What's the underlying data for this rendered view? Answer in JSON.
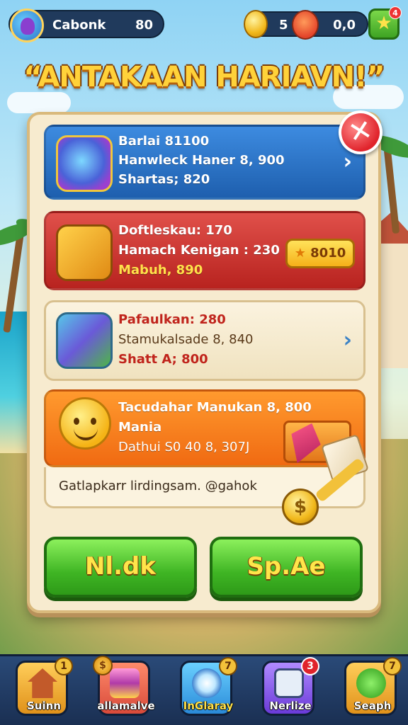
{
  "hud": {
    "player_name": "Cabonk",
    "player_level": "80",
    "coins": "5",
    "gems": "0,0",
    "plus_label": "★",
    "plus_badge": "4"
  },
  "title": "“ANTAKAAN HARIAVN!”",
  "close_label": "✕",
  "tasks": [
    {
      "line1": "Barlai 81100",
      "line2": "Hanwleck Haner 8, 900",
      "line3": "Shartas; 820",
      "icon": "globe-crown-icon",
      "action": "›"
    },
    {
      "line1": "Doftleskau: 170",
      "line2": "Hamach Kenigan : 230",
      "line3": "Mabuh, 890",
      "icon": "treasure-chest-icon",
      "reward_label": "8010",
      "reward_icon": "★"
    },
    {
      "line1": "Pafaulkan: 280",
      "line2": "Stamukalsade 8, 840",
      "line3": "Shatt A; 800",
      "icon": "crate-icon",
      "action": "›"
    },
    {
      "line1": "Tacudahar Manukan 8, 800",
      "line2": "Mania",
      "line3": "Dathui S0 40 8, 307J",
      "icon": "smiley-fruit-icon",
      "footer": "Gatlapkarr lirdingsam. @gahok"
    }
  ],
  "loot_coin": "$",
  "buttons": {
    "left": "Nl.dk",
    "right": "Sp.Ae"
  },
  "nav": [
    {
      "label": "Suinn",
      "badge": "1",
      "icon": "house-icon"
    },
    {
      "label": "allamalve",
      "badge": "$",
      "icon": "gift-chest-icon"
    },
    {
      "label": "InGlaray",
      "badge": "7",
      "icon": "compass-icon"
    },
    {
      "label": "Nerlize",
      "badge": "3",
      "icon": "mail-icon"
    },
    {
      "label": "Seaph",
      "badge": "7",
      "icon": "leaf-icon"
    }
  ]
}
